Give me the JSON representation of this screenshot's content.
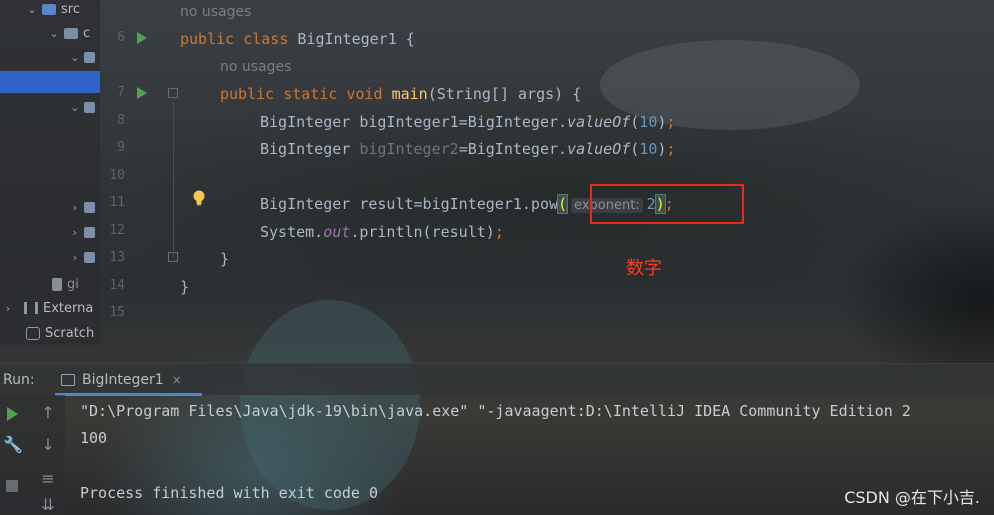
{
  "project_tree": {
    "items": [
      {
        "label": "src"
      },
      {
        "label": "c"
      },
      {
        "label": ""
      },
      {
        "label": ""
      },
      {
        "label": ""
      },
      {
        "label": ""
      },
      {
        "label": ""
      },
      {
        "label": "gi"
      },
      {
        "label": "Externa"
      },
      {
        "label": "Scratch"
      }
    ]
  },
  "editor": {
    "line_numbers": [
      "6",
      "7",
      "8",
      "9",
      "10",
      "11",
      "12",
      "13",
      "14",
      "15"
    ],
    "usage_hint_1": "no usages",
    "usage_hint_2": "no usages",
    "code": {
      "l6_kw": "public class ",
      "l6_name": "BigInteger1 {",
      "l7_kw": "public static void ",
      "l7_fn": "main",
      "l7_rest": "(String[] args) {",
      "l8_a": "BigInteger bigInteger1=BigInteger.",
      "l8_fn": "valueOf",
      "l8_paren_open": "(",
      "l8_num": "10",
      "l8_close": ")",
      "l8_semi": ";",
      "l9_type": "BigInteger ",
      "l9_var": "bigInteger2",
      "l9_b": "=BigInteger.",
      "l9_fn": "valueOf",
      "l9_paren_open": "(",
      "l9_num": "10",
      "l9_close": ")",
      "l9_semi": ";",
      "l11_a": "BigInteger result=bigInteger1.pow",
      "l11_open": "(",
      "l11_hint": "exponent:",
      "l11_num": "2",
      "l11_close": ")",
      "l11_semi": ";",
      "l12_a": "System.",
      "l12_field": "out",
      "l12_b": ".println(result)",
      "l12_semi": ";",
      "l13": "}",
      "l14": "}"
    },
    "annotation": "数字"
  },
  "run_panel": {
    "label": "Run:",
    "tab_title": "BigInteger1",
    "tab_close": "×",
    "console": [
      "\"D:\\Program Files\\Java\\jdk-19\\bin\\java.exe\" \"-javaagent:D:\\IntelliJ IDEA Community Edition 2",
      "100",
      "",
      "Process finished with exit code 0"
    ]
  },
  "watermark": "CSDN @在下小吉."
}
